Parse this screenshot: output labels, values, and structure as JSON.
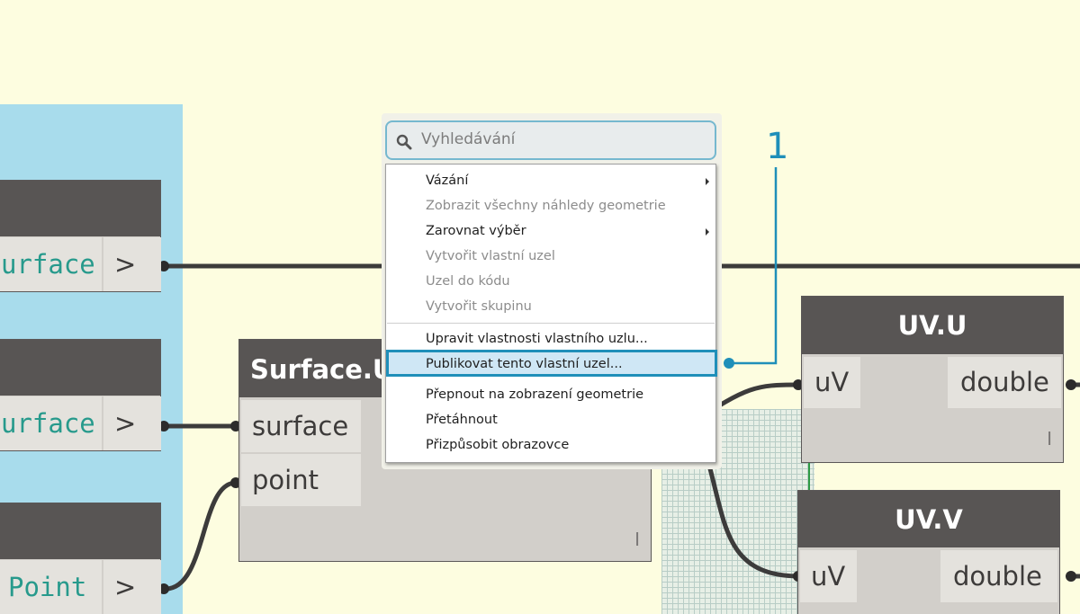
{
  "canvas": {
    "background": "#fdfde0",
    "group_color": "#a8dcec",
    "accent": "#1f8fb9"
  },
  "input_nodes": [
    {
      "value": "urface",
      "output": ">"
    },
    {
      "value": "urface",
      "output": ">"
    },
    {
      "value": "Point",
      "output": ">"
    }
  ],
  "surface_node": {
    "title": "Surface.UV",
    "inputs": [
      "surface",
      "point"
    ],
    "lacing": "I"
  },
  "uvu_node": {
    "title": "UV.U",
    "input": "uV",
    "output": "double",
    "lacing": "I"
  },
  "uvv_node": {
    "title": "UV.V",
    "input": "uV",
    "output": "double"
  },
  "context_menu": {
    "search_placeholder": "Vyhledávání",
    "search_icon": "search-icon",
    "items": [
      {
        "label": "Vázání",
        "enabled": true,
        "submenu": true
      },
      {
        "label": "Zobrazit všechny náhledy geometrie",
        "enabled": false,
        "submenu": false
      },
      {
        "label": "Zarovnat výběr",
        "enabled": true,
        "submenu": true
      },
      {
        "label": "Vytvořit vlastní uzel",
        "enabled": false,
        "submenu": false
      },
      {
        "label": "Uzel do kódu",
        "enabled": false,
        "submenu": false
      },
      {
        "label": "Vytvořit skupinu",
        "enabled": false,
        "submenu": false
      },
      {
        "label": "Upravit vlastnosti vlastního uzlu...",
        "enabled": true,
        "submenu": false
      },
      {
        "label": "Publikovat tento vlastní uzel...",
        "enabled": true,
        "submenu": false,
        "highlighted": true
      },
      {
        "label": "Přepnout na zobrazení geometrie",
        "enabled": true,
        "submenu": false
      },
      {
        "label": "Přetáhnout",
        "enabled": true,
        "submenu": false
      },
      {
        "label": "Přizpůsobit obrazovce",
        "enabled": true,
        "submenu": false
      }
    ]
  },
  "callout": {
    "number": "1"
  }
}
